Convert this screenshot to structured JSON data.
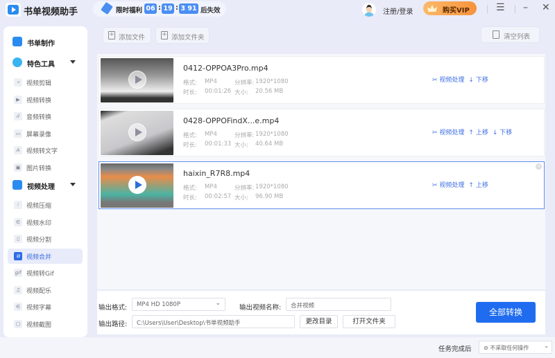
{
  "app": {
    "title": "书单视频助手"
  },
  "promo": {
    "label": "限时福利",
    "hours": "06",
    "minutes": "19",
    "seconds": "32",
    "centis": "91",
    "suffix": "后失效"
  },
  "header": {
    "login": "注册/登录",
    "vip": "购买VIP"
  },
  "sidebar": {
    "top": "书单制作",
    "sections": [
      {
        "label": "特色工具",
        "items": [
          {
            "label": "视频剪辑",
            "icon": "crop-icon"
          },
          {
            "label": "视频转换",
            "icon": "play-icon"
          },
          {
            "label": "音频转换",
            "icon": "audio-icon"
          },
          {
            "label": "屏幕录像",
            "icon": "camera-icon"
          },
          {
            "label": "视频转文字",
            "icon": "text-icon"
          },
          {
            "label": "图片转换",
            "icon": "image-icon"
          }
        ]
      },
      {
        "label": "视频处理",
        "items": [
          {
            "label": "视频压缩",
            "icon": "compress-icon"
          },
          {
            "label": "视频水印",
            "icon": "watermark-icon"
          },
          {
            "label": "视频分割",
            "icon": "split-icon"
          },
          {
            "label": "视频合并",
            "icon": "merge-icon",
            "active": true
          },
          {
            "label": "视频转Gif",
            "icon": "gif-icon"
          },
          {
            "label": "视频配乐",
            "icon": "music-icon"
          },
          {
            "label": "视频字幕",
            "icon": "subtitle-icon"
          },
          {
            "label": "视频截图",
            "icon": "screenshot-icon"
          }
        ]
      }
    ]
  },
  "toolbar": {
    "add_file": "添加文件",
    "add_folder": "添加文件夹",
    "clear": "清空列表"
  },
  "labels": {
    "format": "格式:",
    "resolution": "分辨率:",
    "duration": "时长:",
    "size": "大小:",
    "process": "视频处理",
    "up": "上移",
    "down": "下移"
  },
  "files": [
    {
      "name": "0412-OPPOA3Pro.mp4",
      "format": "MP4",
      "resolution": "1920*1080",
      "duration": "00:01:26",
      "size": "20.56 MB"
    },
    {
      "name": "0428-OPPOFindX...e.mp4",
      "format": "MP4",
      "resolution": "1920*1080",
      "duration": "00:01:33",
      "size": "40.64 MB"
    },
    {
      "name": "haixin_R7R8.mp4",
      "format": "MP4",
      "resolution": "1920*1080",
      "duration": "00:02:57",
      "size": "96.90 MB"
    }
  ],
  "output": {
    "format_label": "输出格式:",
    "format_value": "MP4  HD 1080P",
    "name_label": "输出视频名称:",
    "name_value": "合并视频",
    "path_label": "输出路径:",
    "path_value": "C:\\Users\\User\\Desktop\\书单视频助手",
    "change_dir": "更改目录",
    "open_folder": "打开文件夹",
    "convert_all": "全部转换"
  },
  "footer": {
    "after_label": "任务完成后",
    "after_value": "不采取任何操作"
  }
}
